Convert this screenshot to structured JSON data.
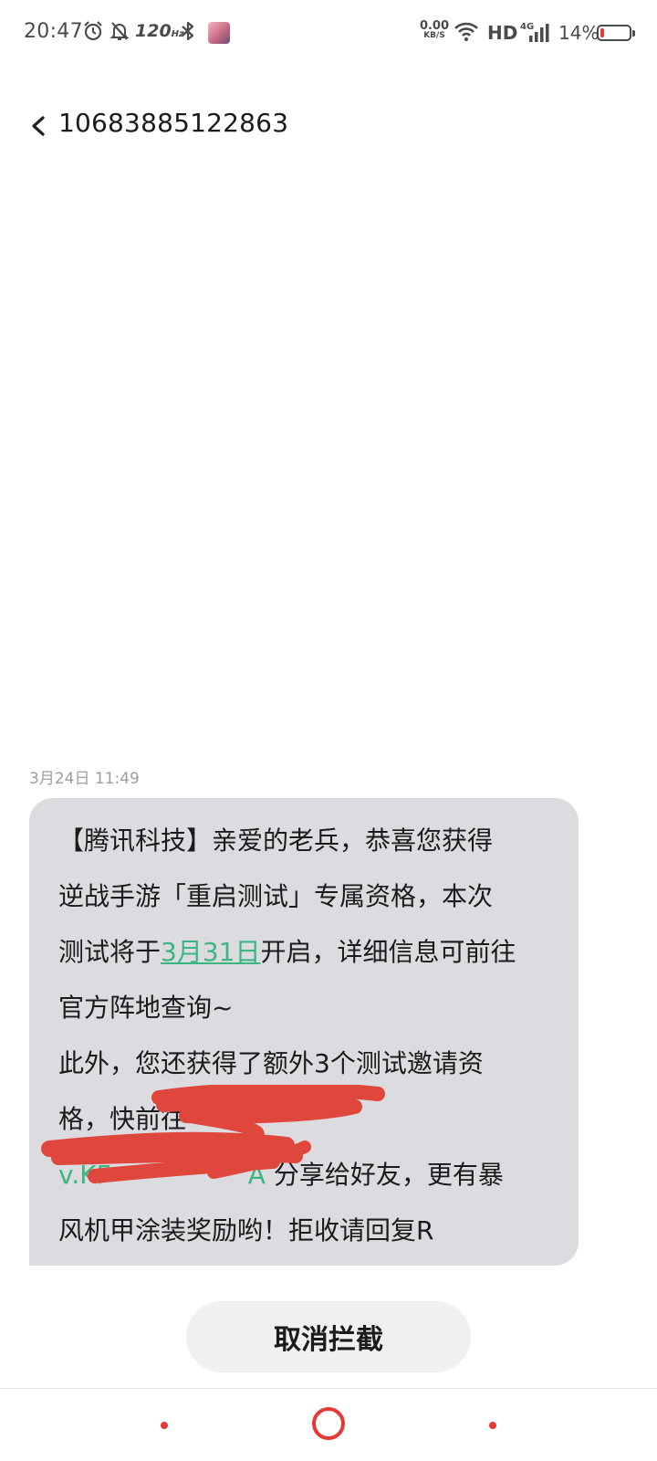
{
  "status_bar": {
    "time": "20:47",
    "refresh_rate": "120",
    "refresh_unit": "Hz",
    "net_speed_value": "0.00",
    "net_speed_unit": "KB/S",
    "hd_label": "HD",
    "network_type": "4G",
    "battery_percent": "14%",
    "battery_level": 0.14
  },
  "header": {
    "title": "10683885122863"
  },
  "message": {
    "timestamp": "3月24日 11:49",
    "lines": {
      "l1": "【腾讯科技】亲爱的老兵，恭喜您获得",
      "l2": "逆战手游「重启测试」专属资格，本次",
      "l3_before": "测试将于",
      "l3_link": "3月31日",
      "l3_after": "开启，详细信息可前往",
      "l4": "官方阵地查询~",
      "l5": "此外，您还获得了额外3个测试邀请资",
      "l6": "格，快前往",
      "l7_link_fragment": "v.KF",
      "l7_link_fragment_end": "A",
      "l7_after": " 分享给好友，更有暴",
      "l8": "风机甲涂装奖励哟！拒收请回复R"
    }
  },
  "actions": {
    "unblock_label": "取消拦截"
  },
  "colors": {
    "bubble": "#dcdce0",
    "link": "#3cb680",
    "redaction": "#e0473c",
    "nav_accent": "#e53935"
  }
}
